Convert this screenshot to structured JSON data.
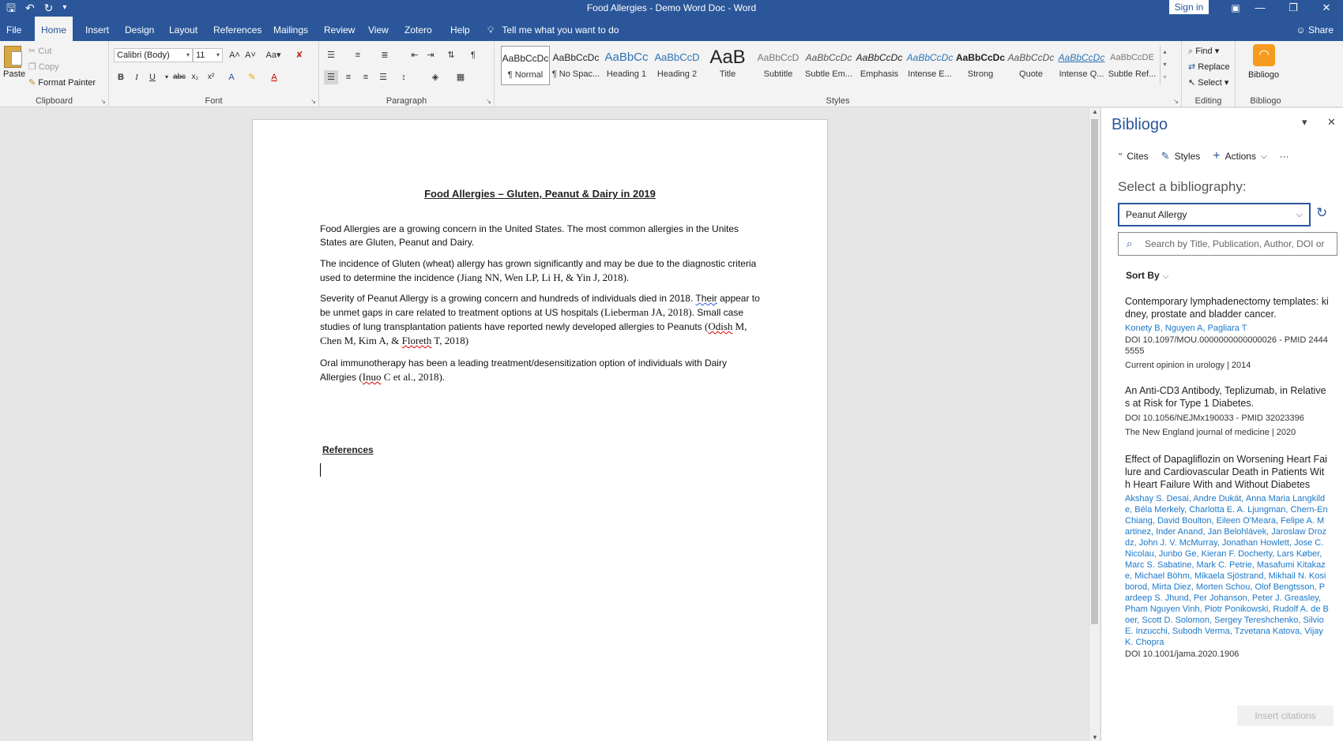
{
  "window": {
    "title": "Food Allergies - Demo Word Doc  -  Word",
    "sign_in": "Sign in",
    "share": "Share"
  },
  "tabs": [
    {
      "label": "File"
    },
    {
      "label": "Home"
    },
    {
      "label": "Insert"
    },
    {
      "label": "Design"
    },
    {
      "label": "Layout"
    },
    {
      "label": "References"
    },
    {
      "label": "Mailings"
    },
    {
      "label": "Review"
    },
    {
      "label": "View"
    },
    {
      "label": "Zotero"
    },
    {
      "label": "Help"
    }
  ],
  "tell_me": "Tell me what you want to do",
  "ribbon": {
    "clipboard": {
      "label": "Clipboard",
      "paste": "Paste",
      "cut": "Cut",
      "copy": "Copy",
      "format_painter": "Format Painter"
    },
    "font": {
      "label": "Font",
      "font_name": "Calibri (Body)",
      "font_size": "11"
    },
    "paragraph": {
      "label": "Paragraph"
    },
    "styles": {
      "label": "Styles",
      "items": [
        {
          "sample": "AaBbCcDc",
          "name": "¶ Normal"
        },
        {
          "sample": "AaBbCcDc",
          "name": "¶ No Spac..."
        },
        {
          "sample": "AaBbCc",
          "name": "Heading 1"
        },
        {
          "sample": "AaBbCcD",
          "name": "Heading 2"
        },
        {
          "sample": "AaB",
          "name": "Title"
        },
        {
          "sample": "AaBbCcD",
          "name": "Subtitle"
        },
        {
          "sample": "AaBbCcDc",
          "name": "Subtle Em..."
        },
        {
          "sample": "AaBbCcDc",
          "name": "Emphasis"
        },
        {
          "sample": "AaBbCcDc",
          "name": "Intense E..."
        },
        {
          "sample": "AaBbCcDc",
          "name": "Strong"
        },
        {
          "sample": "AaBbCcDc",
          "name": "Quote"
        },
        {
          "sample": "AaBbCcDc",
          "name": "Intense Q..."
        },
        {
          "sample": "AaBbCcDE",
          "name": "Subtle Ref..."
        }
      ]
    },
    "editing": {
      "label": "Editing",
      "find": "Find",
      "replace": "Replace",
      "select": "Select"
    },
    "bibliogo": {
      "label": "Bibliogo",
      "button": "Bibliogo"
    }
  },
  "document": {
    "heading": "Food Allergies – Gluten, Peanut & Dairy in 2019",
    "p1": "Food Allergies are a growing concern in the United States. The most common allergies in the Unites States are Gluten, Peanut and Dairy.",
    "p2_text": "The incidence of Gluten (wheat) allergy has grown significantly and may be due to the diagnostic criteria used to determine the incidence ",
    "p2_cite": "(Jiang NN, Wen LP, Li H, & Yin J, 2018).",
    "p3_a": "Severity of Peanut Allergy is a growing concern and hundreds of individuals died in 2018. ",
    "p3_their": "Their",
    "p3_b": " appear to be unmet gaps in care related to treatment options at US hospitals ",
    "p3_cite1": "(Lieberman JA, 2018).",
    "p3_c": " Small case studies of lung transplantation patients have reported newly developed allergies to Peanuts ",
    "p3_cite2a": "(",
    "p3_cite2_odish": "Odish",
    "p3_cite2b": " M, Chen M, Kim A, & ",
    "p3_cite2_floreth": "Floreth",
    "p3_cite2c": " T, 2018)",
    "p4_text": "Oral immunotherapy has been a leading treatment/desensitization option of individuals with Dairy Allergies ",
    "p4_cite_a": "(",
    "p4_cite_inuo": "Inuo",
    "p4_cite_b": " C et al., 2018).",
    "references": "References"
  },
  "pane": {
    "title": "Bibliogo",
    "toolbar": {
      "cites": "Cites",
      "styles": "Styles",
      "actions": "Actions",
      "more": "···"
    },
    "select_label": "Select a bibliography:",
    "selected_bibliography": "Peanut Allergy",
    "search_placeholder": "Search by Title, Publication, Author, DOI or",
    "sort_by": "Sort By",
    "references": [
      {
        "title": "Contemporary lymphadenectomy templates: kidney, prostate and bladder cancer.",
        "authors": "Konety B, Nguyen A, Pagliara T",
        "doi": "DOI 10.1097/MOU.0000000000000026 - PMID 24445555",
        "journal": "Current opinion in urology | 2014"
      },
      {
        "title": "An Anti-CD3 Antibody, Teplizumab, in Relatives at Risk for Type 1 Diabetes.",
        "authors": "",
        "doi": "DOI 10.1056/NEJMx190033 - PMID 32023396",
        "journal": "The New England journal of medicine | 2020"
      },
      {
        "title": "Effect of Dapagliflozin on Worsening Heart Failure and Cardiovascular Death in Patients With Heart Failure With and Without Diabetes",
        "authors": "Akshay S. Desai, Andre Dukát, Anna Maria Langkilde, Béla Merkely, Charlotta E. A. Ljungman, Chern-En Chiang, David Boulton, Eileen O'Meara, Felipe A. Martinez, Inder Anand, Jan Belohlávek, Jaroslaw Drozdz, John J. V. McMurray, Jonathan Howlett, Jose C. Nicolau, Junbo Ge, Kieran F. Docherty, Lars Køber, Marc S. Sabatine, Mark C. Petrie, Masafumi Kitakaze, Michael Böhm, Mikaela Sjöstrand, Mikhail N. Kosiborod, Mirta Diez, Morten Schou, Olof Bengtsson, Pardeep S. Jhund, Per Johanson, Peter J. Greasley, Pham Nguyen Vinh, Piotr Ponikowski, Rudolf A. de Boer, Scott D. Solomon, Sergey Tereshchenko, Silvio E. Inzucchi, Subodh Verma, Tzvetana Katova, Vijay K. Chopra",
        "doi": "DOI 10.1001/jama.2020.1906",
        "journal": ""
      }
    ],
    "insert_button": "Insert citations"
  },
  "colors": {
    "brand": "#2b579a",
    "link": "#1b78c9",
    "addin_icon": "#f59c20"
  }
}
